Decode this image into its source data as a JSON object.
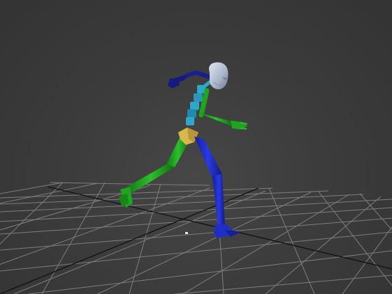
{
  "viewport": {
    "background_color": "#3c3c3c",
    "grid_color": "#8a8a8a",
    "grid_axis_color": "#111111"
  },
  "biped": {
    "head_color": "#a8b4c8",
    "spine_color": "#2fa7c9",
    "left_side_color": "#1f2fc4",
    "right_side_color": "#1fa51f",
    "pelvis_color": "#d8b84e",
    "left_arm_color": "#1a1f8f"
  }
}
